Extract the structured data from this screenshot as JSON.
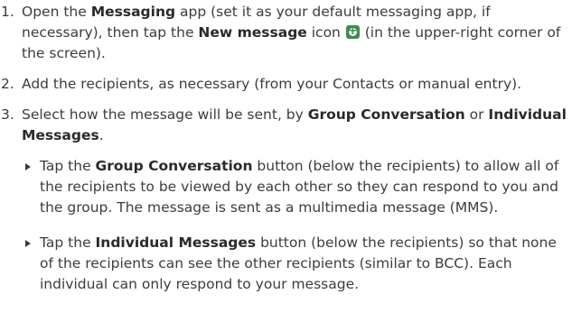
{
  "steps": [
    {
      "number": "1.",
      "t1": "Open the ",
      "b1": "Messaging",
      "t2": " app (set it as your default messaging app, if necessary), then tap the ",
      "b2": "New message",
      "t3": " icon ",
      "t4": " (in the upper-right corner of the screen).",
      "icon": "new-message-plus-icon",
      "icon_color": "#3d8d4a"
    },
    {
      "number": "2.",
      "text": "Add the recipients, as necessary (from your Contacts or manual entry)."
    },
    {
      "number": "3.",
      "t1": "Select how the message will be sent, by ",
      "b1": "Group Conversation",
      "t2": " or ",
      "b2": "Individual Messages",
      "t3": "."
    }
  ],
  "bullets": [
    {
      "t1": "Tap the ",
      "b1": "Group Conversation",
      "t2": " button (below the recipients) to allow all of the recipients to be viewed by each other so they can respond to you and the group. The message is sent as a multimedia message (MMS)."
    },
    {
      "t1": "Tap the ",
      "b1": "Individual Messages",
      "t2": " button (below the recipients) so that none of the recipients can see the other recipients (similar to BCC). Each individual can only respond to your message."
    }
  ]
}
